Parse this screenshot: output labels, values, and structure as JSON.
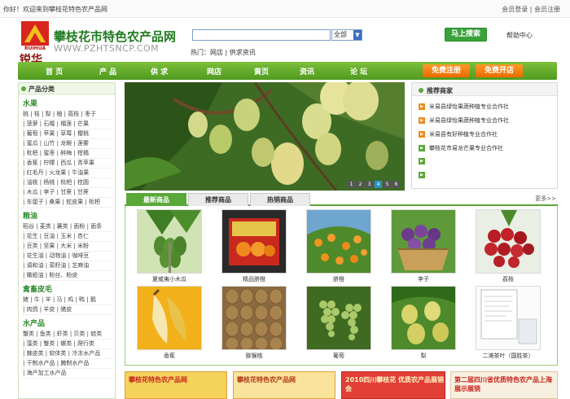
{
  "topbar": {
    "welcome": "你好！欢迎来到攀枝花特色农产品网",
    "login": "会员登录",
    "sep": " | ",
    "register": "会员注册"
  },
  "header": {
    "logo_en": "RUIHUA",
    "logo_cn": "锐华",
    "title": "攀枝花市特色农产品网",
    "url": "WWW.PZHTSNCP.COM"
  },
  "search": {
    "value": "",
    "select_value": "全部",
    "button": "马上搜索",
    "help": "帮助中心",
    "hot_label": "热门：",
    "hot_links": [
      "网店",
      "供求资讯"
    ]
  },
  "nav": {
    "items": [
      "首  页",
      "产  品",
      "供  求",
      "网店",
      "黄页",
      "资讯",
      "论  坛"
    ],
    "register": "免费注册",
    "open_shop": "免费开店"
  },
  "sidebar": {
    "title": "产品分类",
    "sections": [
      {
        "heading": "水果",
        "rows": [
          "桃 | 桔 | 梨 | 柚 | 荔枝 | 枣子",
          "| 菠萝 | 石榴 | 榴莲 | 芒果",
          "| 葡萄 | 苹果 | 草莓 | 樱桃",
          "| 蜜瓜 | 山竹 | 龙眼 | 莲雾",
          "| 枇杷 | 蜜枣 | 醉梅 | 柑橘",
          "| 香蕉 | 柠檬 | 西瓜 | 青苹果",
          "| 红毛丹 | 火龙果 | 牛油果",
          "| 油桃 | 杨桃 | 枇杷 | 桂圆",
          "| 木瓜 | 李子 | 甘蔗 | 甘蔗",
          "| 车厘子 | 桑果 | 蛇皮果 | 枇杷"
        ]
      },
      {
        "heading": "粮油",
        "rows": [
          "稻谷 | 麦类 | 薯类 | 面粉 | 面条",
          "| 花生 | 豆油 | 玉米 | 杏仁",
          "| 豆类 | 坚果 | 大米 | 米粉",
          "| 花生油 | 动物油 | 咖啡豆",
          "| 调和油 | 菜籽油 | 芝麻油",
          "| 橄榄油 | 粉丝、粉皮"
        ]
      },
      {
        "heading": "禽畜皮毛",
        "rows": [
          "猪 | 牛 | 羊 | 马 | 鸡 | 鸭 | 鹅",
          "| 肉鸽 | 羊皮 | 猪皮"
        ]
      },
      {
        "heading": "水产品",
        "rows": [
          "蟹类 | 鱼类 | 虾类 | 贝类 | 蛙类",
          "| 藻类 | 蟹类 | 螺类 | 爬行类",
          "| 棘皮类 | 软体类 | 冷冻水产品",
          "| 干制水产品 | 腌制水产品",
          "| 海产加工水产品"
        ]
      }
    ]
  },
  "banner": {
    "slides": [
      "1",
      "2",
      "3",
      "4",
      "5",
      "6"
    ],
    "active": 4
  },
  "recommended": {
    "title": "推荐商家",
    "items": [
      "米易县绿怡果蔬种植专业合作社",
      "米易县绿怡果蔬种植专业合作社",
      "米易县有好种植专业合作社",
      "攀枝花市易龙芒果专业合作社",
      "",
      ""
    ]
  },
  "tabs": {
    "items": [
      "最新商品",
      "推荐商品",
      "热销商品"
    ],
    "active": 0,
    "more": "更多>>"
  },
  "products": [
    {
      "name": "夏威夷小木瓜"
    },
    {
      "name": "精品脐橙"
    },
    {
      "name": "脐橙"
    },
    {
      "name": "李子"
    },
    {
      "name": "荔枝"
    },
    {
      "name": "香蕉"
    },
    {
      "name": "猕猴桃"
    },
    {
      "name": "葡萄"
    },
    {
      "name": "梨"
    },
    {
      "name": "二滩茶叶（国胜茶）"
    }
  ],
  "ads": [
    {
      "text": "攀枝花特色农产品网"
    },
    {
      "text": "攀枝花特色农产品网"
    },
    {
      "text": "2010四川攀枝花 优质农产品展销会"
    },
    {
      "text": "第二届四川省优质特色农产品上海展示展销"
    }
  ],
  "colors": {
    "nav_green": "#5aa83a",
    "brand_red": "#d8261e",
    "orange": "#f08a1c",
    "link_green": "#2e8a2e"
  }
}
